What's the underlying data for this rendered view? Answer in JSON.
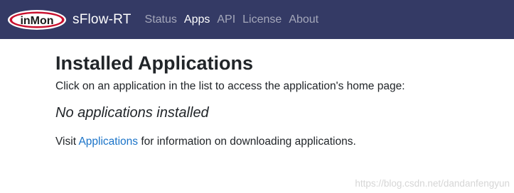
{
  "colors": {
    "navbar_bg": "#343a65",
    "link": "#1a73c8",
    "logo_red": "#c8102e"
  },
  "brand": {
    "logo_text": "inMon",
    "app_name": "sFlow-RT"
  },
  "nav": {
    "items": [
      {
        "label": "Status",
        "active": false
      },
      {
        "label": "Apps",
        "active": true
      },
      {
        "label": "API",
        "active": false
      },
      {
        "label": "License",
        "active": false
      },
      {
        "label": "About",
        "active": false
      }
    ]
  },
  "main": {
    "title": "Installed Applications",
    "description": "Click on an application in the list to access the application's home page:",
    "empty_message": "No applications installed",
    "visit_prefix": "Visit ",
    "visit_link": "Applications",
    "visit_suffix": " for information on downloading applications."
  },
  "watermark": "https://blog.csdn.net/dandanfengyun"
}
